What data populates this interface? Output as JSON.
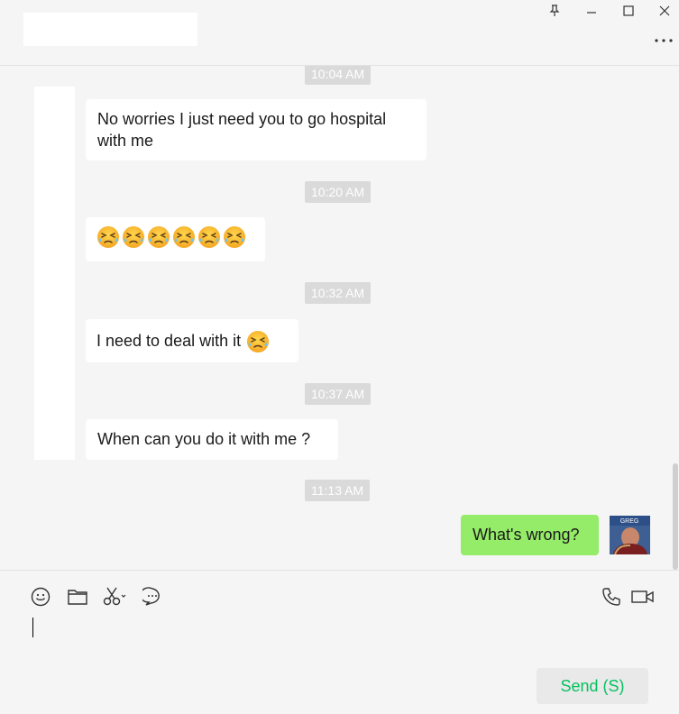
{
  "chat": {
    "messages": [
      {
        "time": "10:04 AM",
        "text": "No worries I just need you to go hospital",
        "text2": "with me"
      },
      {
        "time": "10:20 AM",
        "emoji_count": 6,
        "emoji": "tears-of-joy-squint-emoji"
      },
      {
        "time": "10:32 AM",
        "text": "I need to deal with it",
        "emoji": "tears-of-joy-squint-emoji"
      },
      {
        "time": "10:37 AM",
        "text": "When can you do it with me ?"
      },
      {
        "time": "11:13 AM",
        "text": "What's wrong?",
        "from_me": true
      }
    ],
    "avatar_badge": "GREG"
  },
  "composer": {
    "send_label": "Send (S)",
    "tools": [
      "emoji-icon",
      "folder-icon",
      "scissors-icon",
      "chat-history-icon"
    ],
    "call_tools": [
      "phone-icon",
      "video-call-icon"
    ]
  },
  "colors": {
    "my_bubble": "#95ec69",
    "their_bubble": "#ffffff",
    "send_text": "#07c160",
    "background": "#f5f5f5"
  }
}
